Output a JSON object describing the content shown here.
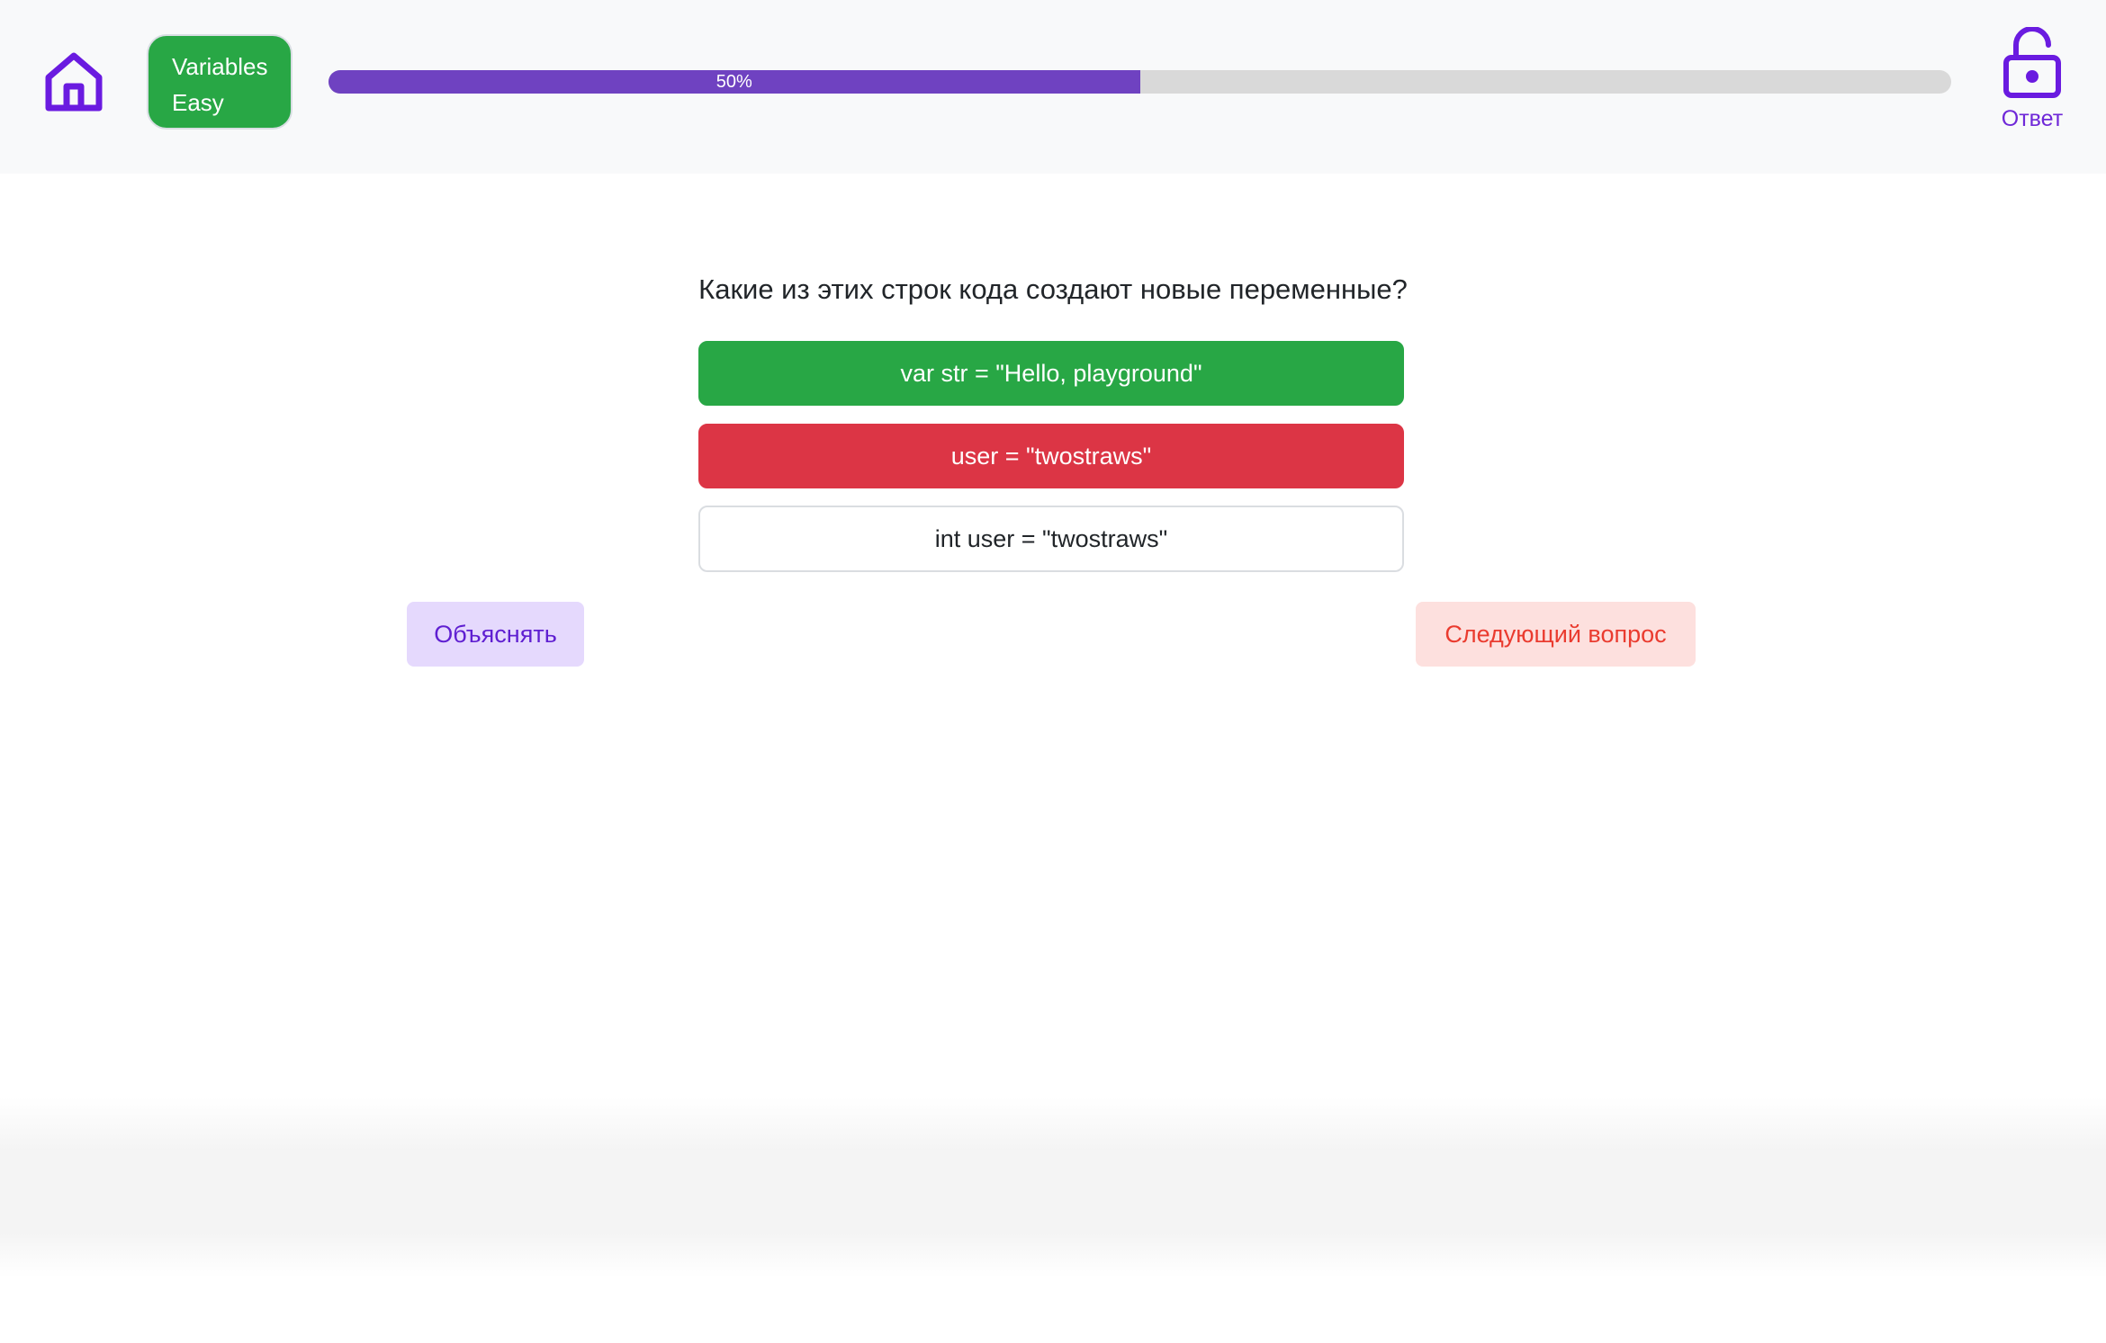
{
  "header": {
    "home_icon": "home-icon",
    "topic": {
      "name": "Variables",
      "level": "Easy",
      "color": "#28a745"
    },
    "progress": {
      "percent": 50,
      "label": "50%",
      "fill_color": "#6f42c1"
    },
    "answer": {
      "icon": "unlock-icon",
      "label": "Ответ"
    }
  },
  "question": {
    "text": "Какие из этих строк кода создают новые переменные?",
    "options": [
      {
        "label": "var str = \"Hello, playground\"",
        "state": "correct"
      },
      {
        "label": "user = \"twostraws\"",
        "state": "wrong"
      },
      {
        "label": "int user = \"twostraws\"",
        "state": "neutral"
      }
    ]
  },
  "actions": {
    "explain_label": "Объяснять",
    "next_label": "Следующий вопрос"
  },
  "colors": {
    "accent": "#6f28d8",
    "correct": "#28a745",
    "wrong": "#dc3545"
  }
}
